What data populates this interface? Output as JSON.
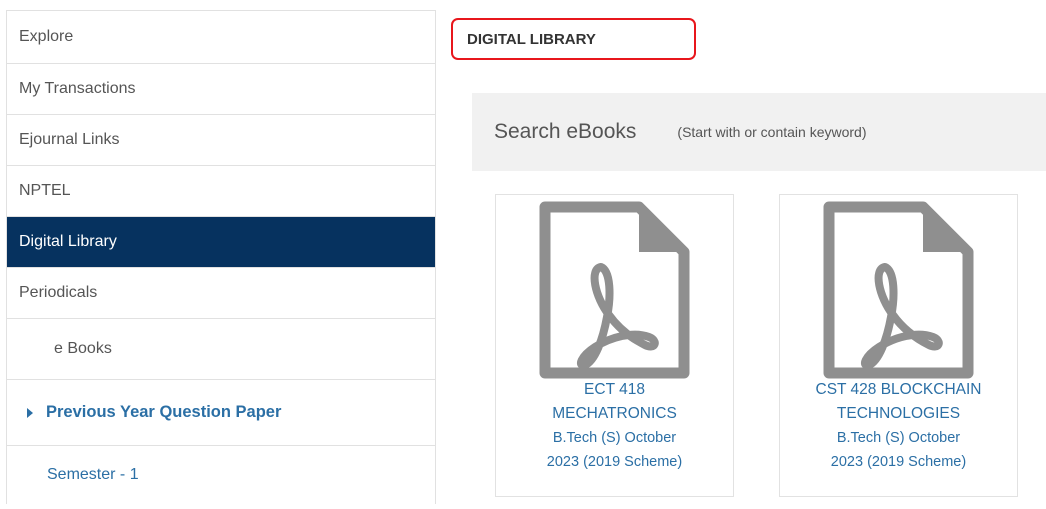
{
  "sidebar": {
    "items": [
      {
        "label": "Explore"
      },
      {
        "label": "My Transactions"
      },
      {
        "label": "Ejournal Links"
      },
      {
        "label": "NPTEL"
      },
      {
        "label": "Digital Library"
      },
      {
        "label": "Periodicals"
      },
      {
        "label": "e Books"
      },
      {
        "label": "Previous Year Question Paper"
      },
      {
        "label": "Semester - 1"
      }
    ],
    "active": "Digital Library",
    "active_color": "#06325f"
  },
  "main": {
    "title": "DIGITAL LIBRARY",
    "search": {
      "label": "Search eBooks",
      "hint": "(Start with or contain keyword)"
    },
    "cards": [
      {
        "icon": "pdf-file-icon",
        "line1": "ECT 418",
        "line2": "MECHATRONICS",
        "line3": "B.Tech (S) October",
        "line4": "2023 (2019 Scheme)"
      },
      {
        "icon": "pdf-file-icon",
        "line1": "CST 428 BLOCKCHAIN",
        "line2": "TECHNOLOGIES",
        "line3": "B.Tech (S) October",
        "line4": "2023 (2019 Scheme)"
      }
    ]
  },
  "colors": {
    "link": "#2b6fa5",
    "highlight_border": "#e8161c",
    "icon_gray": "#8f8f8f"
  }
}
